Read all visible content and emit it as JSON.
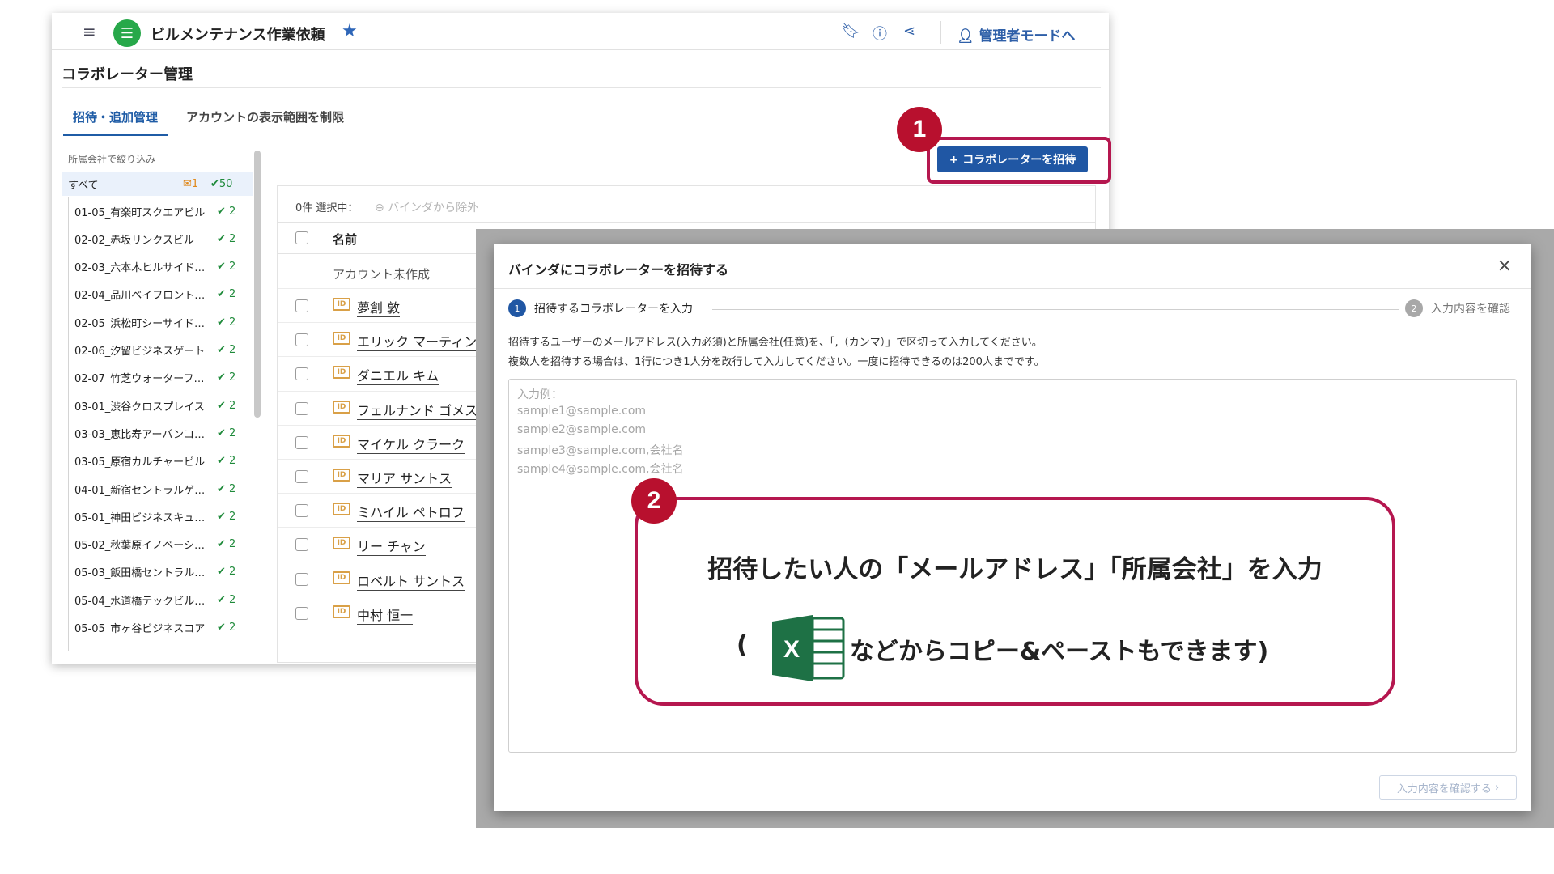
{
  "header": {
    "app_title": "ビルメンテナンス作業依頼",
    "menu_icon": "≡",
    "logo_icon": "list-icon",
    "admin_mode_label": "管理者モードへ"
  },
  "page": {
    "title": "コラボレーター管理",
    "tabs": [
      {
        "label": "招待・追加管理",
        "active": true
      },
      {
        "label": "アカウントの表示範囲を制限",
        "active": false
      }
    ]
  },
  "sidebar": {
    "filter_label": "所属会社で絞り込み",
    "all": {
      "label": "すべて",
      "mail_count": "1",
      "user_count": "50"
    },
    "buildings": [
      {
        "name": "01-05_有楽町スクエアビル",
        "count": "2"
      },
      {
        "name": "02-02_赤坂リンクスビル",
        "count": "2"
      },
      {
        "name": "02-03_六本木ヒルサイド…",
        "count": "2"
      },
      {
        "name": "02-04_品川ベイフロント…",
        "count": "2"
      },
      {
        "name": "02-05_浜松町シーサイド…",
        "count": "2"
      },
      {
        "name": "02-06_汐留ビジネスゲート",
        "count": "2"
      },
      {
        "name": "02-07_竹芝ウォーターフ…",
        "count": "2"
      },
      {
        "name": "03-01_渋谷クロスプレイス",
        "count": "2"
      },
      {
        "name": "03-03_恵比寿アーバンコ…",
        "count": "2"
      },
      {
        "name": "03-05_原宿カルチャービル",
        "count": "2"
      },
      {
        "name": "04-01_新宿セントラルゲ…",
        "count": "2"
      },
      {
        "name": "05-01_神田ビジネスキュ…",
        "count": "2"
      },
      {
        "name": "05-02_秋葉原イノベーシ…",
        "count": "2"
      },
      {
        "name": "05-03_飯田橋セントラル…",
        "count": "2"
      },
      {
        "name": "05-04_水道橋テックビル…",
        "count": "2"
      },
      {
        "name": "05-05_市ヶ谷ビジネスコア",
        "count": "2"
      }
    ]
  },
  "toolbar": {
    "invite_button": "+ コラボレーターを招待"
  },
  "list": {
    "selection_info": "0件 選択中：",
    "exclude_label": "バインダから除外",
    "column_name": "名前",
    "no_account_label": "アカウント未作成",
    "users": [
      "夢創 敦",
      "エリック マーティン",
      "ダニエル キム",
      "フェルナンド ゴメス",
      "マイケル クラーク",
      "マリア サントス",
      "ミハイル ペトロフ",
      "リー チャン",
      "ロベルト サントス",
      "中村 恒一"
    ]
  },
  "dialog": {
    "title": "バインダにコラボレーターを招待する",
    "close": "×",
    "step1_num": "1",
    "step1_label": "招待するコラボレーターを入力",
    "step2_num": "2",
    "step2_label": "入力内容を確認",
    "instruction_1": "招待するユーザーのメールアドレス(入力必須)と所属会社(任意)を、「,（カンマ）」で区切って入力してください。",
    "instruction_2": "複数人を招待する場合は、1行につき1人分を改行して入力してください。一度に招待できるのは200人までです。",
    "placeholder_lines": [
      "入力例：",
      "sample1@sample.com",
      "sample2@sample.com",
      "sample3@sample.com,会社名",
      "sample4@sample.com,会社名"
    ],
    "confirm_button": "入力内容を確認する"
  },
  "annotations": {
    "badge1": "1",
    "badge2": "2",
    "callout_line1": "招待したい人の「メールアドレス」「所属会社」を入力",
    "callout_paren": "(",
    "callout_line2": "などからコピー&ペーストもできます)",
    "excel_letter": "X",
    "accent_color": "#b5174f"
  }
}
